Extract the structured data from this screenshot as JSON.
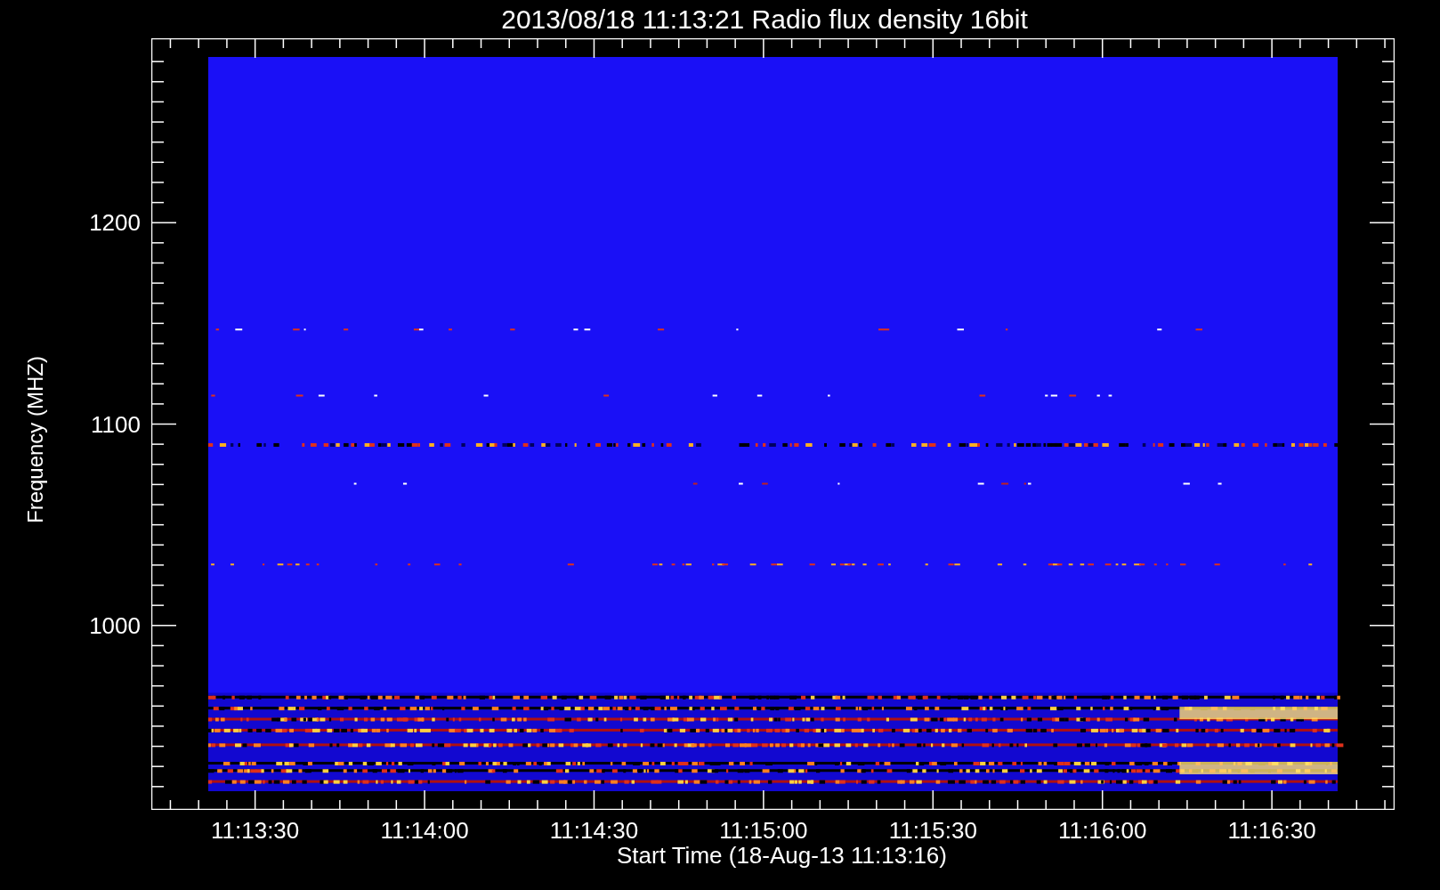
{
  "chart": {
    "title": "2013/08/18 11:13:21 Radio flux density 16bit",
    "xlabel": "Start Time (18-Aug-13 11:13:16)",
    "ylabel": "Frequency (MHZ)",
    "xticks": [
      "11:13:30",
      "11:14:00",
      "11:14:30",
      "11:15:00",
      "11:15:30",
      "11:16:00",
      "11:16:30"
    ],
    "yticks": [
      "1200",
      "1100",
      "1000"
    ]
  }
}
